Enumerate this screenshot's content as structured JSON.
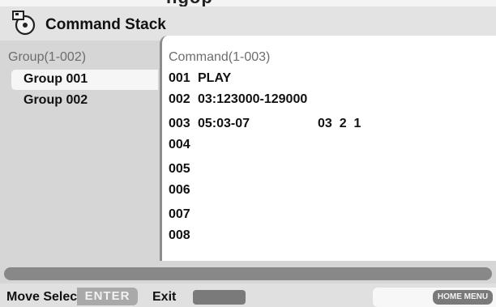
{
  "header": {
    "clipped_title_text": "ngop",
    "title": "Command Stack",
    "icon": "command-stack-icon"
  },
  "groups": {
    "range_label": "Group(1-002)",
    "items": [
      {
        "label": "Group 001",
        "selected": true
      },
      {
        "label": "Group 002",
        "selected": false
      }
    ]
  },
  "commands": {
    "range_label": "Command(1-003)",
    "rows": [
      {
        "num": "001",
        "text": "PLAY",
        "extra": ""
      },
      {
        "num": "002",
        "text": "03:123000-129000",
        "extra": ""
      },
      {
        "num": "003",
        "text": "05:03-07",
        "extra": "03  2  1"
      },
      {
        "num": "004",
        "text": "",
        "extra": ""
      },
      {
        "num": "005",
        "text": "",
        "extra": ""
      },
      {
        "num": "006",
        "text": "",
        "extra": ""
      },
      {
        "num": "007",
        "text": "",
        "extra": ""
      },
      {
        "num": "008",
        "text": "",
        "extra": ""
      }
    ]
  },
  "footer": {
    "move_select_label": "Move Select",
    "enter_label": "ENTER",
    "exit_label": "Exit",
    "home_menu_label": "HOME MENU"
  },
  "colors": {
    "background": "#d6d6d6",
    "panel": "#ffffff",
    "button_gray": "#7a7a7a"
  }
}
